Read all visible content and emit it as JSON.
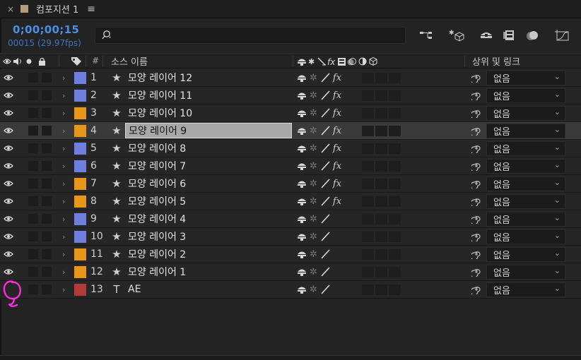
{
  "tab": {
    "close": "×",
    "title": "컴포지션 1",
    "menu": "≡"
  },
  "header": {
    "timecode": "0;00;00;15",
    "frameinfo": "00015 (29.97fps)",
    "search_placeholder": "",
    "search_icon": "⌕",
    "icons": [
      "composition-flowchart-icon",
      "draft-3d-icon",
      "shy-layers-icon",
      "frame-blending-icon",
      "motion-blur-icon",
      "graph-editor-icon"
    ]
  },
  "columns": {
    "av_features": "◉◀●🔒",
    "label_icon": "label-tag-icon",
    "number": "#",
    "source_name": "소스 이름",
    "switches": "switches",
    "parent": "상위 및 링크"
  },
  "colors": {
    "blue": "#6e7fe0",
    "orange": "#e8961a",
    "red": "#b43a3a",
    "accent": "#4a8fe7",
    "annotation": "#ff2bd6"
  },
  "layers": [
    {
      "num": "1",
      "type": "★",
      "name": "모양 레이어 12",
      "color": "blue",
      "fx": true,
      "visible": true,
      "parent": "없음"
    },
    {
      "num": "2",
      "type": "★",
      "name": "모양 레이어 11",
      "color": "blue",
      "fx": true,
      "visible": true,
      "parent": "없음"
    },
    {
      "num": "3",
      "type": "★",
      "name": "모양 레이어 10",
      "color": "orange",
      "fx": true,
      "visible": true,
      "parent": "없음"
    },
    {
      "num": "4",
      "type": "★",
      "name": "모양 레이어 9",
      "color": "orange",
      "fx": true,
      "visible": true,
      "parent": "없음",
      "selected": true
    },
    {
      "num": "5",
      "type": "★",
      "name": "모양 레이어 8",
      "color": "blue",
      "fx": true,
      "visible": true,
      "parent": "없음"
    },
    {
      "num": "6",
      "type": "★",
      "name": "모양 레이어 7",
      "color": "blue",
      "fx": true,
      "visible": true,
      "parent": "없음"
    },
    {
      "num": "7",
      "type": "★",
      "name": "모양 레이어 6",
      "color": "orange",
      "fx": true,
      "visible": true,
      "parent": "없음"
    },
    {
      "num": "8",
      "type": "★",
      "name": "모양 레이어 5",
      "color": "orange",
      "fx": true,
      "visible": true,
      "parent": "없음"
    },
    {
      "num": "9",
      "type": "★",
      "name": "모양 레이어 4",
      "color": "blue",
      "fx": false,
      "visible": true,
      "parent": "없음"
    },
    {
      "num": "10",
      "type": "★",
      "name": "모양 레이어 3",
      "color": "blue",
      "fx": false,
      "visible": true,
      "parent": "없음"
    },
    {
      "num": "11",
      "type": "★",
      "name": "모양 레이어 2",
      "color": "orange",
      "fx": false,
      "visible": true,
      "parent": "없음"
    },
    {
      "num": "12",
      "type": "★",
      "name": "모양 레이어 1",
      "color": "orange",
      "fx": false,
      "visible": true,
      "parent": "없음"
    },
    {
      "num": "13",
      "type": "T",
      "name": "AE",
      "color": "red",
      "fx": false,
      "visible": false,
      "parent": "없음"
    }
  ]
}
